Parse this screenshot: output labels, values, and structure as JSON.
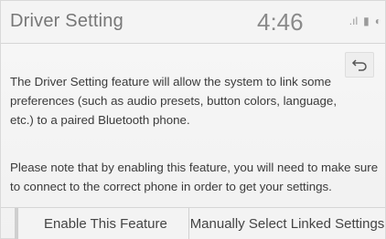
{
  "header": {
    "title": "Driver Setting",
    "clock": "4:46",
    "status_icons": [
      "signal-icon",
      "battery-icon",
      "bluetooth-icon"
    ]
  },
  "back": {
    "icon": "back-arrow-icon"
  },
  "body": {
    "paragraph1": "The Driver Setting feature will allow the system to link some preferences (such as audio presets, button colors, language, etc.) to a paired Bluetooth phone.",
    "paragraph2": "Please note that by enabling this feature, you will need to make sure to connect to the correct phone in order to get your settings."
  },
  "footer": {
    "enable_label": "Enable This Feature",
    "manual_label": "Manually Select Linked Settings"
  }
}
